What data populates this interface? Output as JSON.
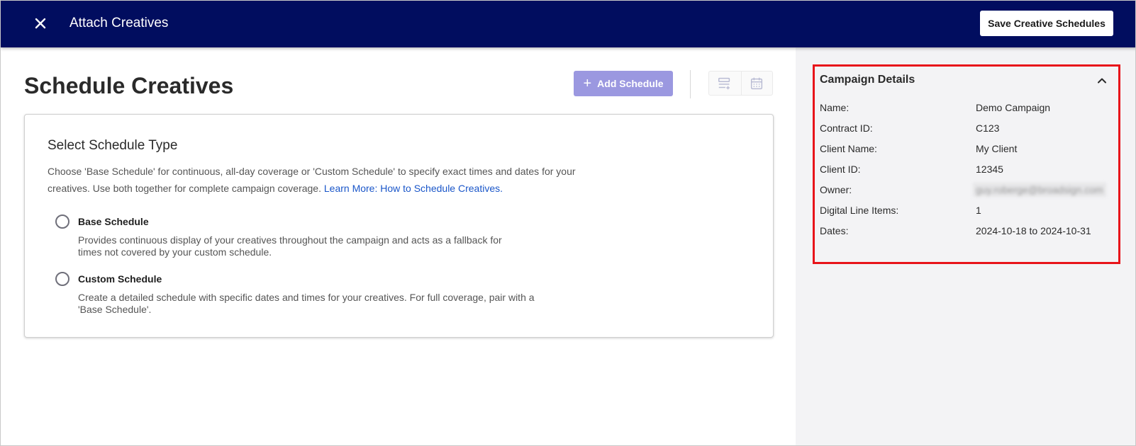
{
  "header": {
    "title": "Attach Creatives",
    "save_label": "Save Creative Schedules"
  },
  "main": {
    "page_title": "Schedule Creatives",
    "add_schedule_label": "Add Schedule",
    "card": {
      "title": "Select Schedule Type",
      "description": "Choose 'Base Schedule' for continuous, all-day coverage or 'Custom Schedule' to specify exact times and dates for your creatives. Use both together for complete campaign coverage. ",
      "learn_more_link": "Learn More: How to Schedule Creatives.",
      "options": [
        {
          "label": "Base Schedule",
          "description": "Provides continuous display of your creatives throughout the campaign and acts as a fallback for times not covered by your custom schedule."
        },
        {
          "label": "Custom Schedule",
          "description": "Create a detailed schedule with specific dates and times for your creatives. For full coverage, pair with a 'Base Schedule'."
        }
      ]
    }
  },
  "side_panel": {
    "title": "Campaign Details",
    "rows": [
      {
        "label": "Name:",
        "value": "Demo Campaign"
      },
      {
        "label": "Contract ID:",
        "value": "C123"
      },
      {
        "label": "Client Name:",
        "value": "My Client"
      },
      {
        "label": "Client ID:",
        "value": "12345"
      },
      {
        "label": "Owner:",
        "value": "guy.roberge@broadsign.com"
      },
      {
        "label": "Digital Line Items:",
        "value": "1"
      },
      {
        "label": "Dates:",
        "value": "2024-10-18 to 2024-10-31"
      }
    ]
  },
  "colors": {
    "header_bg": "#010d5f",
    "primary_button_disabled": "#9b98e0",
    "link": "#1a56c9",
    "highlight_border": "#e8141a",
    "side_panel_bg": "#f3f3f5"
  },
  "icons": {
    "close": "close-icon",
    "plus": "plus-icon",
    "list_view": "list-view-icon",
    "calendar_view": "calendar-icon",
    "collapse": "chevron-up-icon"
  }
}
